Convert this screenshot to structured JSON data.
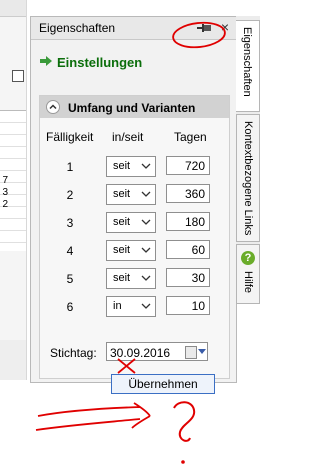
{
  "panel": {
    "title": "Eigenschaften",
    "close_glyph": "×",
    "pin_icon": "pin-icon",
    "section_title": "Einstellungen"
  },
  "group": {
    "title": "Umfang und Varianten",
    "headers": {
      "due": "Fälligkeit",
      "inout": "in/seit",
      "days": "Tagen"
    },
    "rows": [
      {
        "num": "1",
        "mode": "seit",
        "days": "720"
      },
      {
        "num": "2",
        "mode": "seit",
        "days": "360"
      },
      {
        "num": "3",
        "mode": "seit",
        "days": "180"
      },
      {
        "num": "4",
        "mode": "seit",
        "days": "60"
      },
      {
        "num": "5",
        "mode": "seit",
        "days": "30"
      },
      {
        "num": "6",
        "mode": "in",
        "days": "10"
      }
    ],
    "stichtag_label": "Stichtag:",
    "stichtag_value": "30.09.2016",
    "apply_button": "Übernehmen"
  },
  "tabs": [
    {
      "label": "Eigenschaften"
    },
    {
      "label": "Kontextbezogene Links"
    },
    {
      "label": "Hilfe"
    }
  ],
  "left_sheet": {
    "digits": [
      "7",
      "3",
      "2"
    ]
  },
  "annotation_colors": {
    "red": "#e00000"
  }
}
